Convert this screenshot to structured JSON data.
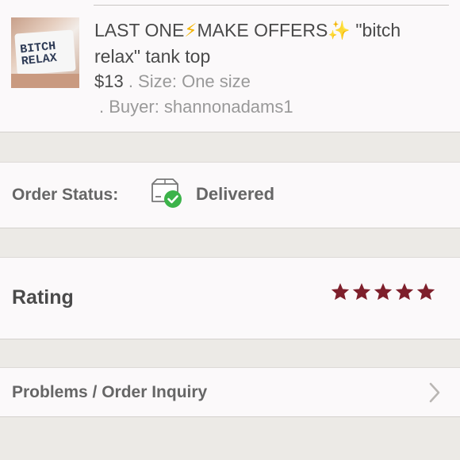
{
  "listing": {
    "image_text": "BITCH RELAX",
    "title_part1": "LAST ONE",
    "bolt_icon": "⚡",
    "title_part2": "MAKE OFFERS",
    "sparkle_icon": "✨",
    "title_part3": " \"bitch relax\" tank top",
    "price": "$13",
    "size_text": " . Size: One size",
    "buyer_text": ". Buyer: shannonadams1"
  },
  "order_status": {
    "label": "Order Status:",
    "value": "Delivered",
    "icon": "delivered-box-icon",
    "check_color": "#3cb34a"
  },
  "rating": {
    "label": "Rating",
    "stars": 5,
    "max_stars": 5,
    "star_color": "#7e1f2b"
  },
  "problems": {
    "label": "Problems / Order Inquiry",
    "icon": "chevron-right-icon"
  }
}
